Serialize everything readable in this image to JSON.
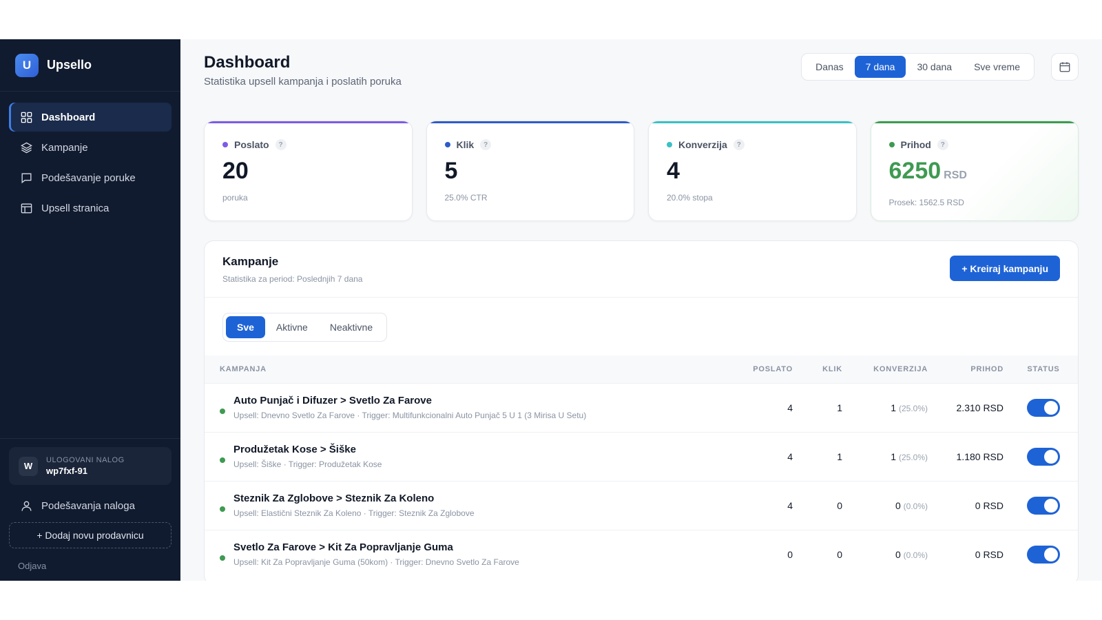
{
  "brand": {
    "logo_letter": "U",
    "name": "Upsello"
  },
  "nav": [
    {
      "label": "Dashboard",
      "icon": "grid-icon",
      "active": true
    },
    {
      "label": "Kampanje",
      "icon": "layers-icon",
      "active": false
    },
    {
      "label": "Podešavanje poruke",
      "icon": "message-icon",
      "active": false
    },
    {
      "label": "Upsell stranica",
      "icon": "layout-icon",
      "active": false
    }
  ],
  "account": {
    "label": "ULOGOVANI NALOG",
    "avatar_letter": "W",
    "name": "wp7fxf-91"
  },
  "sidebar_bottom": {
    "settings": "Podešavanja naloga",
    "add_store": "+ Dodaj novu prodavnicu",
    "logout": "Odjava"
  },
  "header": {
    "title": "Dashboard",
    "subtitle": "Statistika upsell kampanja i poslatih poruka",
    "ranges": [
      "Danas",
      "7 dana",
      "30 dana",
      "Sve vreme"
    ],
    "active_range": "7 dana"
  },
  "stats": [
    {
      "label": "Poslato",
      "value": "20",
      "unit": "",
      "sub": "poruka",
      "color": "#7c5ce6",
      "help": "?"
    },
    {
      "label": "Klik",
      "value": "5",
      "unit": "",
      "sub": "25.0% CTR",
      "color": "#2f5bc9",
      "help": "?"
    },
    {
      "label": "Konverzija",
      "value": "4",
      "unit": "",
      "sub": "20.0% stopa",
      "color": "#3cc0c5",
      "help": "?"
    },
    {
      "label": "Prihod",
      "value": "6250",
      "unit": "RSD",
      "sub": "Prosek: 1562.5 RSD",
      "color": "#3f9a52",
      "help": "?"
    }
  ],
  "campaigns": {
    "title": "Kampanje",
    "subtitle": "Statistika za period: Poslednjih 7 dana",
    "create_label": "+ Kreiraj kampanju",
    "filters": [
      "Sve",
      "Aktivne",
      "Neaktivne"
    ],
    "active_filter": "Sve",
    "columns": [
      "KAMPANJA",
      "POSLATO",
      "KLIK",
      "KONVERZIJA",
      "PRIHOD",
      "STATUS"
    ],
    "rows": [
      {
        "name": "Auto Punjač i Difuzer > Svetlo Za Farove",
        "meta": "Upsell: Dnevno Svetlo Za Farove · Trigger: Multifunkcionalni Auto Punjač 5 U 1 (3 Mirisa U Setu)",
        "sent": "4",
        "clicks": "1",
        "conv": "1",
        "conv_pct": "(25.0%)",
        "revenue": "2.310 RSD",
        "active": true
      },
      {
        "name": "Produžetak Kose > Šiške",
        "meta": "Upsell: Šiške · Trigger: Produžetak Kose",
        "sent": "4",
        "clicks": "1",
        "conv": "1",
        "conv_pct": "(25.0%)",
        "revenue": "1.180 RSD",
        "active": true
      },
      {
        "name": "Steznik Za Zglobove > Steznik Za Koleno",
        "meta": "Upsell: Elastični Steznik Za Koleno · Trigger: Steznik Za Zglobove",
        "sent": "4",
        "clicks": "0",
        "conv": "0",
        "conv_pct": "(0.0%)",
        "revenue": "0 RSD",
        "active": true
      },
      {
        "name": "Svetlo Za Farove > Kit Za Popravljanje Guma",
        "meta": "Upsell: Kit Za Popravljanje Guma (50kom) · Trigger: Dnevno Svetlo Za Farove",
        "sent": "0",
        "clicks": "0",
        "conv": "0",
        "conv_pct": "(0.0%)",
        "revenue": "0 RSD",
        "active": true
      }
    ]
  }
}
